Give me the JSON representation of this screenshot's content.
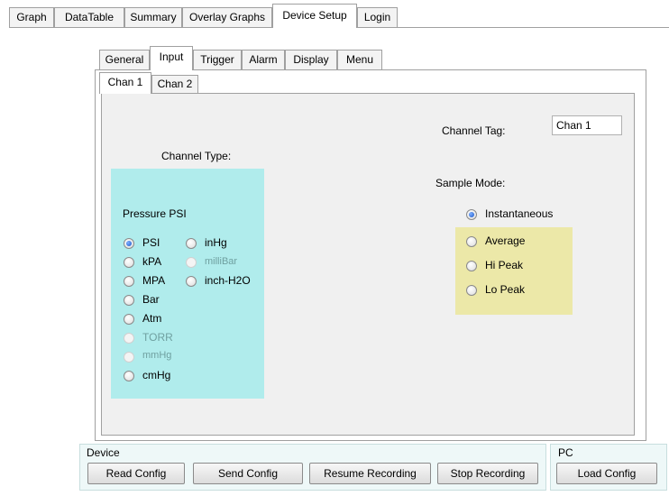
{
  "main_tabs": [
    "Graph",
    "DataTable",
    "Summary",
    "Overlay Graphs",
    "Device Setup",
    "Login"
  ],
  "setup_tabs": [
    "General",
    "Input",
    "Trigger",
    "Alarm",
    "Display",
    "Menu"
  ],
  "chan_tabs": [
    "Chan 1",
    "Chan 2"
  ],
  "channel_tag": {
    "label": "Channel Tag:",
    "value": "Chan 1"
  },
  "channel_type": {
    "label": "Channel Type:",
    "group_title": "Pressure PSI",
    "options": [
      {
        "label": "PSI",
        "checked": true,
        "disabled": false
      },
      {
        "label": "kPA",
        "checked": false,
        "disabled": false
      },
      {
        "label": "MPA",
        "checked": false,
        "disabled": false
      },
      {
        "label": "Bar",
        "checked": false,
        "disabled": false
      },
      {
        "label": "Atm",
        "checked": false,
        "disabled": false
      },
      {
        "label": "TORR",
        "checked": false,
        "disabled": true
      },
      {
        "label": "mmHg",
        "checked": false,
        "disabled": true
      },
      {
        "label": "cmHg",
        "checked": false,
        "disabled": false
      },
      {
        "label": "inHg",
        "checked": false,
        "disabled": false
      },
      {
        "label": "milliBar",
        "checked": false,
        "disabled": true
      },
      {
        "label": "inch-H2O",
        "checked": false,
        "disabled": false
      }
    ]
  },
  "sample_mode": {
    "label": "Sample Mode:",
    "options": [
      {
        "label": "Instantaneous",
        "checked": true
      },
      {
        "label": "Average",
        "checked": false
      },
      {
        "label": "Hi Peak",
        "checked": false
      },
      {
        "label": "Lo Peak",
        "checked": false
      }
    ]
  },
  "device": {
    "title": "Device",
    "buttons": [
      "Read Config",
      "Send Config",
      "Resume Recording",
      "Stop Recording"
    ]
  },
  "pc": {
    "title": "PC",
    "buttons": [
      "Load Config"
    ]
  },
  "colors": {
    "type_group_bg": "#b0ecec",
    "mode_group_bg": "#ece8a8",
    "panel_bg": "#f0f0f0"
  }
}
